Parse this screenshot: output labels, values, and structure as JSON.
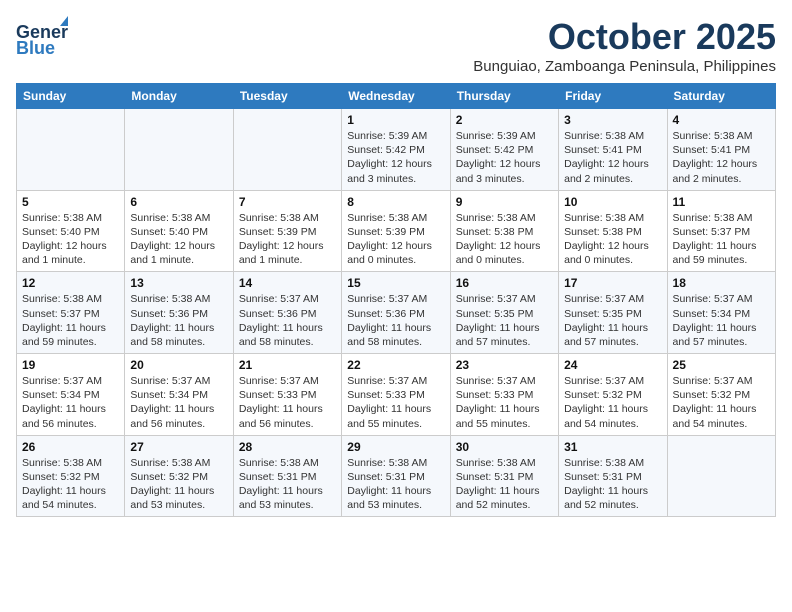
{
  "header": {
    "logo_line1": "General",
    "logo_line2": "Blue",
    "title": "October 2025",
    "location": "Bunguiao, Zamboanga Peninsula, Philippines"
  },
  "weekdays": [
    "Sunday",
    "Monday",
    "Tuesday",
    "Wednesday",
    "Thursday",
    "Friday",
    "Saturday"
  ],
  "weeks": [
    [
      {
        "day": "",
        "info": ""
      },
      {
        "day": "",
        "info": ""
      },
      {
        "day": "",
        "info": ""
      },
      {
        "day": "1",
        "info": "Sunrise: 5:39 AM\nSunset: 5:42 PM\nDaylight: 12 hours and 3 minutes."
      },
      {
        "day": "2",
        "info": "Sunrise: 5:39 AM\nSunset: 5:42 PM\nDaylight: 12 hours and 3 minutes."
      },
      {
        "day": "3",
        "info": "Sunrise: 5:38 AM\nSunset: 5:41 PM\nDaylight: 12 hours and 2 minutes."
      },
      {
        "day": "4",
        "info": "Sunrise: 5:38 AM\nSunset: 5:41 PM\nDaylight: 12 hours and 2 minutes."
      }
    ],
    [
      {
        "day": "5",
        "info": "Sunrise: 5:38 AM\nSunset: 5:40 PM\nDaylight: 12 hours and 1 minute."
      },
      {
        "day": "6",
        "info": "Sunrise: 5:38 AM\nSunset: 5:40 PM\nDaylight: 12 hours and 1 minute."
      },
      {
        "day": "7",
        "info": "Sunrise: 5:38 AM\nSunset: 5:39 PM\nDaylight: 12 hours and 1 minute."
      },
      {
        "day": "8",
        "info": "Sunrise: 5:38 AM\nSunset: 5:39 PM\nDaylight: 12 hours and 0 minutes."
      },
      {
        "day": "9",
        "info": "Sunrise: 5:38 AM\nSunset: 5:38 PM\nDaylight: 12 hours and 0 minutes."
      },
      {
        "day": "10",
        "info": "Sunrise: 5:38 AM\nSunset: 5:38 PM\nDaylight: 12 hours and 0 minutes."
      },
      {
        "day": "11",
        "info": "Sunrise: 5:38 AM\nSunset: 5:37 PM\nDaylight: 11 hours and 59 minutes."
      }
    ],
    [
      {
        "day": "12",
        "info": "Sunrise: 5:38 AM\nSunset: 5:37 PM\nDaylight: 11 hours and 59 minutes."
      },
      {
        "day": "13",
        "info": "Sunrise: 5:38 AM\nSunset: 5:36 PM\nDaylight: 11 hours and 58 minutes."
      },
      {
        "day": "14",
        "info": "Sunrise: 5:37 AM\nSunset: 5:36 PM\nDaylight: 11 hours and 58 minutes."
      },
      {
        "day": "15",
        "info": "Sunrise: 5:37 AM\nSunset: 5:36 PM\nDaylight: 11 hours and 58 minutes."
      },
      {
        "day": "16",
        "info": "Sunrise: 5:37 AM\nSunset: 5:35 PM\nDaylight: 11 hours and 57 minutes."
      },
      {
        "day": "17",
        "info": "Sunrise: 5:37 AM\nSunset: 5:35 PM\nDaylight: 11 hours and 57 minutes."
      },
      {
        "day": "18",
        "info": "Sunrise: 5:37 AM\nSunset: 5:34 PM\nDaylight: 11 hours and 57 minutes."
      }
    ],
    [
      {
        "day": "19",
        "info": "Sunrise: 5:37 AM\nSunset: 5:34 PM\nDaylight: 11 hours and 56 minutes."
      },
      {
        "day": "20",
        "info": "Sunrise: 5:37 AM\nSunset: 5:34 PM\nDaylight: 11 hours and 56 minutes."
      },
      {
        "day": "21",
        "info": "Sunrise: 5:37 AM\nSunset: 5:33 PM\nDaylight: 11 hours and 56 minutes."
      },
      {
        "day": "22",
        "info": "Sunrise: 5:37 AM\nSunset: 5:33 PM\nDaylight: 11 hours and 55 minutes."
      },
      {
        "day": "23",
        "info": "Sunrise: 5:37 AM\nSunset: 5:33 PM\nDaylight: 11 hours and 55 minutes."
      },
      {
        "day": "24",
        "info": "Sunrise: 5:37 AM\nSunset: 5:32 PM\nDaylight: 11 hours and 54 minutes."
      },
      {
        "day": "25",
        "info": "Sunrise: 5:37 AM\nSunset: 5:32 PM\nDaylight: 11 hours and 54 minutes."
      }
    ],
    [
      {
        "day": "26",
        "info": "Sunrise: 5:38 AM\nSunset: 5:32 PM\nDaylight: 11 hours and 54 minutes."
      },
      {
        "day": "27",
        "info": "Sunrise: 5:38 AM\nSunset: 5:32 PM\nDaylight: 11 hours and 53 minutes."
      },
      {
        "day": "28",
        "info": "Sunrise: 5:38 AM\nSunset: 5:31 PM\nDaylight: 11 hours and 53 minutes."
      },
      {
        "day": "29",
        "info": "Sunrise: 5:38 AM\nSunset: 5:31 PM\nDaylight: 11 hours and 53 minutes."
      },
      {
        "day": "30",
        "info": "Sunrise: 5:38 AM\nSunset: 5:31 PM\nDaylight: 11 hours and 52 minutes."
      },
      {
        "day": "31",
        "info": "Sunrise: 5:38 AM\nSunset: 5:31 PM\nDaylight: 11 hours and 52 minutes."
      },
      {
        "day": "",
        "info": ""
      }
    ]
  ]
}
